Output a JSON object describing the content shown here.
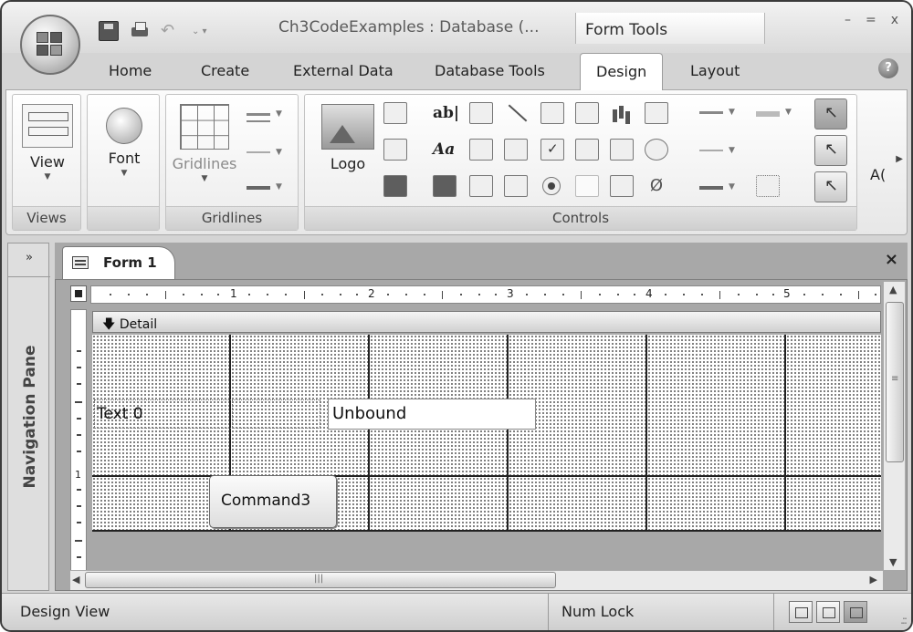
{
  "title_bar": {
    "document_title": "Ch3CodeExamples : Database (...",
    "context_tab": "Form Tools",
    "minimize_glyph": "–",
    "restore_glyph": "=",
    "close_glyph": "x",
    "undo_glyph": "↶",
    "dropdown_glyph": "⌄ ▾"
  },
  "tabs": [
    "Home",
    "Create",
    "External Data",
    "Database Tools",
    "Design",
    "Layout"
  ],
  "active_tab": "Design",
  "help_glyph": "?",
  "ribbon": {
    "views": {
      "button": "View",
      "group": "Views"
    },
    "font": {
      "button": "Font"
    },
    "gridlines": {
      "button": "Gridlines",
      "group": "Gridlines"
    },
    "controls": {
      "logo_button": "Logo",
      "text_box_glyph": "ab|",
      "label_glyph": "Aa",
      "group": "Controls"
    },
    "truncated_group": "A("
  },
  "navigation_pane": {
    "label": "Navigation Pane",
    "toggle": "»"
  },
  "document_tab": {
    "name": "Form 1",
    "close": "×"
  },
  "ruler": {
    "horizontal": [
      "1",
      "2",
      "3",
      "4",
      "5"
    ],
    "vertical": [
      "1"
    ]
  },
  "form": {
    "section": "Detail",
    "section_glyph": "🡇",
    "label_control": "Text 0",
    "textbox_control": "Unbound",
    "button_control": "Command3"
  },
  "scrollbar_grip": "|||",
  "status_bar": {
    "mode": "Design View",
    "indicator": "Num Lock"
  },
  "colors": {
    "accent": "#5e5e5e",
    "canvas": "#ffffff",
    "workspace": "#a8a8a8"
  }
}
